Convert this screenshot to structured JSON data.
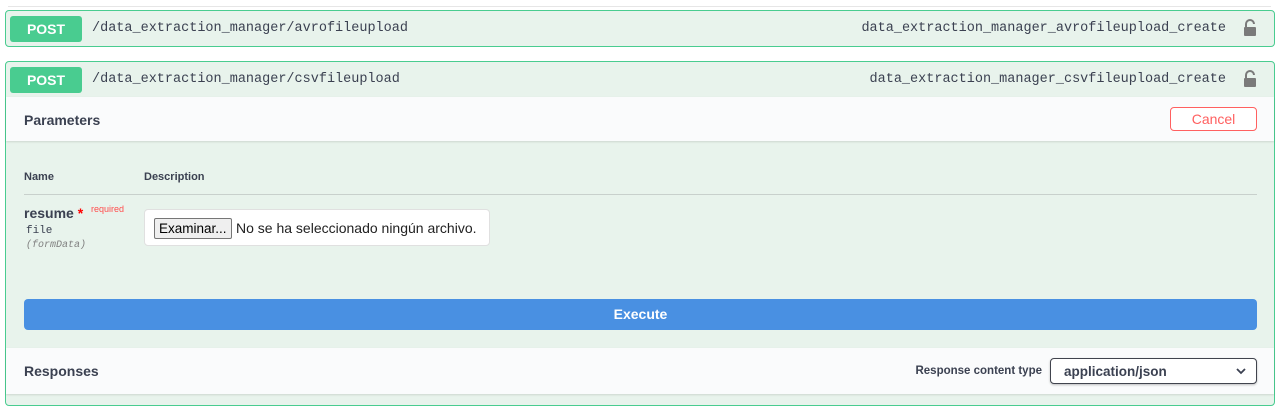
{
  "operations": [
    {
      "method": "POST",
      "path": "/data_extraction_manager/avrofileupload",
      "operation_id": "data_extraction_manager_avrofileupload_create"
    },
    {
      "method": "POST",
      "path": "/data_extraction_manager/csvfileupload",
      "operation_id": "data_extraction_manager_csvfileupload_create",
      "parameters": {
        "title": "Parameters",
        "cancel_label": "Cancel",
        "columns": {
          "name": "Name",
          "description": "Description"
        },
        "items": [
          {
            "name": "resume",
            "required_mark": "*",
            "required_label": "required",
            "type": "file",
            "in": "(formData)",
            "file_button": "Examinar...",
            "file_status": "No se ha seleccionado ningún archivo."
          }
        ]
      },
      "execute_label": "Execute",
      "responses": {
        "title": "Responses",
        "content_type_label": "Response content type",
        "content_type_value": "application/json"
      }
    }
  ],
  "colors": {
    "post": "#49cc90",
    "execute": "#4990e2",
    "cancel": "#ff6060",
    "block_bg": "#e8f3ec"
  },
  "icons": {
    "lock": "lock-icon",
    "chevron": "chevron-down-icon"
  }
}
